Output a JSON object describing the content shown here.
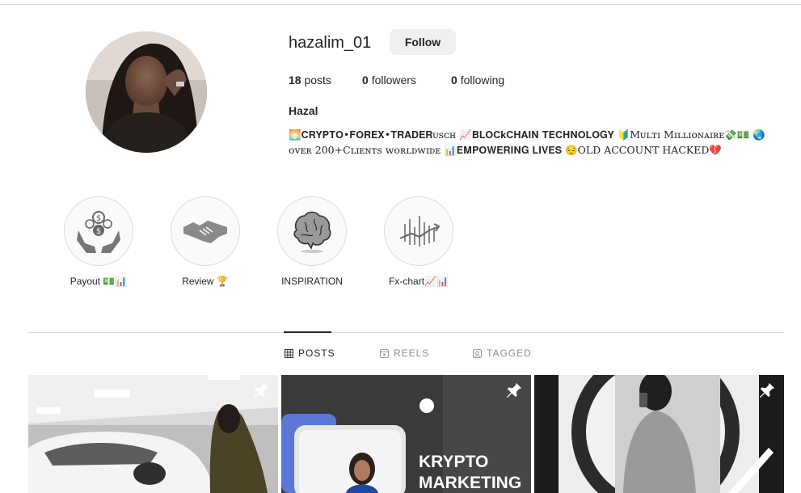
{
  "profile": {
    "username": "hazalim_01",
    "follow_label": "Follow",
    "stats": {
      "posts_count": "18",
      "posts_label": "posts",
      "followers_count": "0",
      "followers_label": "followers",
      "following_count": "0",
      "following_label": "following"
    },
    "full_name": "Hazal",
    "bio": "🌅𝐂𝐑𝐘𝐏𝐓𝐎•𝐅𝐎𝐑𝐄𝐗•𝐓𝐑𝐀𝐃𝐄𝐑ᴜꜱᴄʜ 📈𝐁𝐋𝐎𝐂𝐤𝐂𝐇𝐀𝐈𝐍 𝐓𝐄𝐂𝐇𝐍𝐎𝐋𝐎𝐆𝐘 🔰Mᴜʟᴛɪ Mɪʟʟɪᴏɴᴀɪʀᴇ💸💵 🌏\nᴏᴠᴇʀ 200+Cʟɪᴇɴᴛꜱ ᴡᴏʀʟᴅᴡɪᴅᴇ 📊𝐄𝐌𝐏𝐎𝐖𝐄𝐑𝐈𝐍𝐆 𝐋𝐈𝐕𝐄𝐒 😔OLD ACCOUNT HACKED💔"
  },
  "highlights": [
    {
      "label": "Payout 💵📊",
      "icon": "money-hands-icon"
    },
    {
      "label": "Review 🏆",
      "icon": "handshake-icon"
    },
    {
      "label": "INSPIRATION",
      "icon": "brain-icon"
    },
    {
      "label": "Fx-chart📈📊",
      "icon": "chart-icon"
    }
  ],
  "tabs": [
    {
      "label": "POSTS",
      "icon": "grid-icon",
      "active": true
    },
    {
      "label": "REELS",
      "icon": "reels-icon",
      "active": false
    },
    {
      "label": "TAGGED",
      "icon": "tagged-icon",
      "active": false
    }
  ],
  "posts": [
    {
      "pinned": true,
      "caption": ""
    },
    {
      "pinned": true,
      "caption": "KRYPTO\nMARKETING"
    },
    {
      "pinned": true,
      "caption": ""
    }
  ],
  "colors": {
    "border": "#dbdbdb",
    "button_bg": "#efefef",
    "text": "#262626",
    "muted": "#8e8e8e"
  }
}
